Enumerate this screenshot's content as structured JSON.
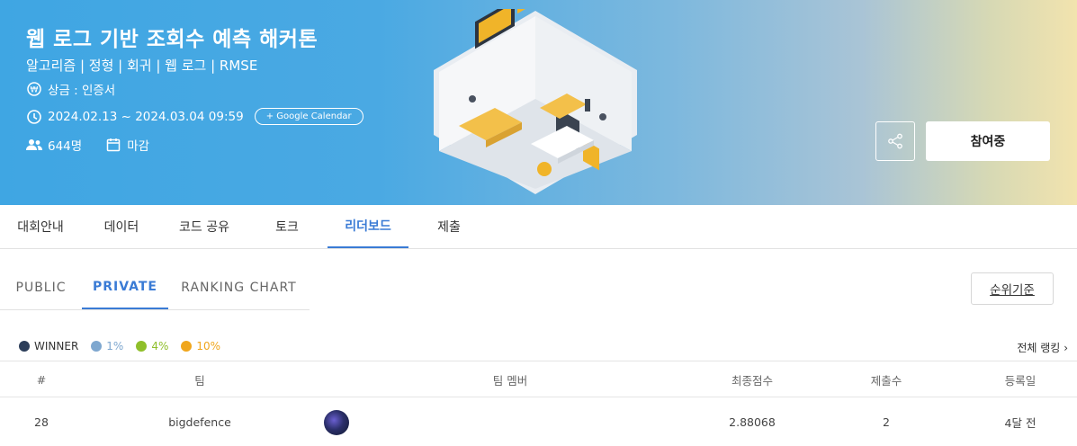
{
  "banner": {
    "title": "웹 로그 기반 조회수 예측 해커톤",
    "tags": "알고리즘 | 정형 | 회귀 | 웹 로그 | RMSE",
    "prize": "상금 : 인증서",
    "period": "2024.02.13 ~ 2024.03.04 09:59",
    "gcal": "+ Google Calendar",
    "participants": "644명",
    "status": "마감",
    "join_label": "참여중"
  },
  "tabs": [
    {
      "label": "대회안내"
    },
    {
      "label": "데이터"
    },
    {
      "label": "코드 공유"
    },
    {
      "label": "토크"
    },
    {
      "label": "리더보드",
      "active": true
    },
    {
      "label": "제출"
    }
  ],
  "subtabs": [
    {
      "label": "PUBLIC"
    },
    {
      "label": "PRIVATE",
      "active": true
    },
    {
      "label": "RANKING CHART"
    }
  ],
  "rank_criteria_label": "순위기준",
  "legend": [
    {
      "label": "WINNER",
      "color": "#2c3e5a"
    },
    {
      "label": "1%",
      "color": "#7ea7cf"
    },
    {
      "label": "4%",
      "color": "#8fbf2a"
    },
    {
      "label": "10%",
      "color": "#f0a61c"
    }
  ],
  "all_ranking_label": "전체 랭킹",
  "table": {
    "headers": [
      "#",
      "팀",
      "팀 멤버",
      "최종점수",
      "제출수",
      "등록일"
    ],
    "rows": [
      {
        "rank": "28",
        "team": "bigdefence",
        "score": "2.88068",
        "submissions": "2",
        "registered": "4달 전"
      }
    ]
  },
  "colors": {
    "accent": "#3a7bd5"
  }
}
